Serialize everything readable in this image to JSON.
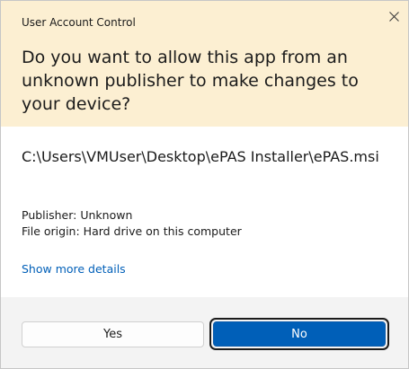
{
  "window": {
    "title": "User Account Control"
  },
  "header": {
    "question": "Do you want to allow this app from an unknown publisher to make changes to your device?"
  },
  "details": {
    "program_path": "C:\\Users\\VMUser\\Desktop\\ePAS Installer\\ePAS.msi",
    "publisher": "Publisher: Unknown",
    "file_origin": "File origin: Hard drive on this computer",
    "show_more_label": "Show more details"
  },
  "buttons": {
    "yes_label": "Yes",
    "no_label": "No"
  },
  "colors": {
    "header_background": "#fcefd2",
    "link": "#005fb8",
    "primary_button": "#005fb8",
    "footer_background": "#f3f3f3"
  },
  "icons": {
    "close": "close-icon"
  }
}
